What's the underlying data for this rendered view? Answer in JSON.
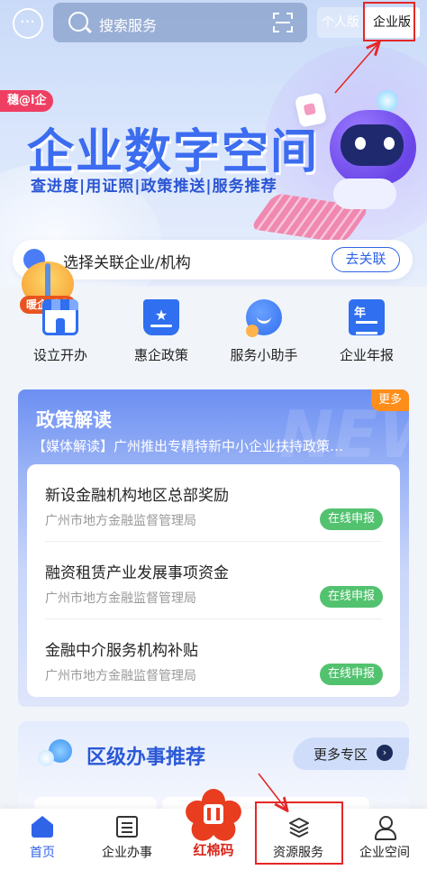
{
  "topbar": {
    "search_placeholder": "搜索服务",
    "mode_personal": "个人版",
    "mode_enterprise": "企业版"
  },
  "banner": {
    "tag": "穗@i企",
    "title": "企业数字空间",
    "subtitle": "查进度|用证照|政策推送|服务推荐"
  },
  "association": {
    "text": "选择关联企业/机构",
    "button": "去关联"
  },
  "warm_appeal": "暖企诉求",
  "quick_functions": [
    {
      "label": "设立开办",
      "icon": "shop-icon"
    },
    {
      "label": "惠企政策",
      "icon": "policy-icon"
    },
    {
      "label": "服务小助手",
      "icon": "assistant-icon"
    },
    {
      "label": "企业年报",
      "icon": "annual-report-icon"
    }
  ],
  "policy": {
    "title": "政策解读",
    "more": "更多",
    "bg_text": "NEW",
    "news": "【媒体解读】广州推出专精特新中小企业扶持政策…",
    "items": [
      {
        "title": "新设金融机构地区总部奖励",
        "org": "广州市地方金融监督管理局",
        "action": "在线申报"
      },
      {
        "title": "融资租赁产业发展事项资金",
        "org": "广州市地方金融监督管理局",
        "action": "在线申报"
      },
      {
        "title": "金融中介服务机构补贴",
        "org": "广州市地方金融监督管理局",
        "action": "在线申报"
      }
    ]
  },
  "district": {
    "title": "区级办事推荐",
    "more": "更多专区"
  },
  "tabbar": {
    "home": "首页",
    "business": "企业办事",
    "kapok": "红棉码",
    "resources": "资源服务",
    "space": "企业空间"
  },
  "colors": {
    "accent": "#2f63e8",
    "annotation": "#e52727",
    "apply_button": "#52c26f",
    "more_tag": "#ff8d1a"
  }
}
